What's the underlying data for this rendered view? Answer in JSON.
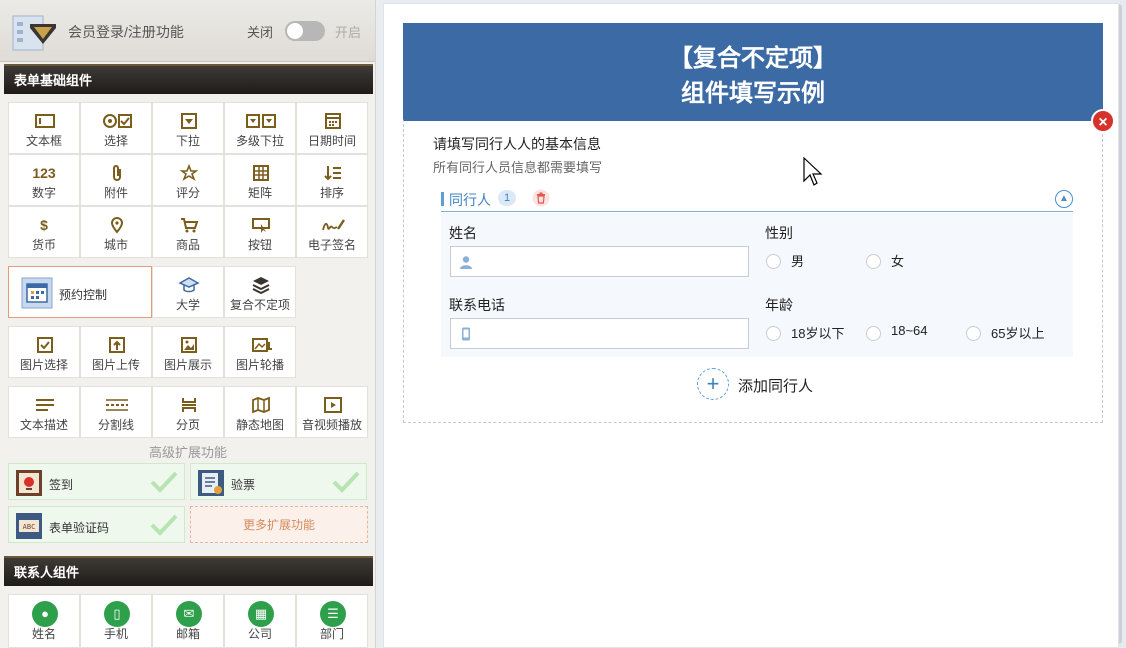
{
  "member": {
    "title": "会员登录/注册功能",
    "toggle_off": "关闭",
    "toggle_on": "开启"
  },
  "basic": {
    "title": "表单基础组件",
    "row1": [
      {
        "label": "文本框",
        "icon": "textbox-icon"
      },
      {
        "label": "选择",
        "icon": "select-icon"
      },
      {
        "label": "下拉",
        "icon": "dropdown-icon"
      },
      {
        "label": "多级下拉",
        "icon": "multi-dropdown-icon"
      },
      {
        "label": "日期时间",
        "icon": "calendar-icon"
      }
    ],
    "row2": [
      {
        "label": "数字",
        "icon": "number-icon",
        "glyph": "123"
      },
      {
        "label": "附件",
        "icon": "attachment-icon"
      },
      {
        "label": "评分",
        "icon": "star-icon"
      },
      {
        "label": "矩阵",
        "icon": "matrix-icon"
      },
      {
        "label": "排序",
        "icon": "sort-icon"
      }
    ],
    "row3": [
      {
        "label": "货币",
        "icon": "currency-icon",
        "glyph": "$"
      },
      {
        "label": "城市",
        "icon": "location-icon"
      },
      {
        "label": "商品",
        "icon": "cart-icon"
      },
      {
        "label": "按钮",
        "icon": "button-icon"
      },
      {
        "label": "电子签名",
        "icon": "signature-icon"
      }
    ],
    "appointment": "预约控制",
    "row4": [
      {
        "label": "大学",
        "icon": "university-icon"
      },
      {
        "label": "复合不定项",
        "icon": "layers-icon"
      }
    ],
    "row5": [
      {
        "label": "图片选择",
        "icon": "image-select-icon"
      },
      {
        "label": "图片上传",
        "icon": "image-upload-icon"
      },
      {
        "label": "图片展示",
        "icon": "image-display-icon"
      },
      {
        "label": "图片轮播",
        "icon": "image-carousel-icon"
      }
    ],
    "row6": [
      {
        "label": "文本描述",
        "icon": "text-desc-icon"
      },
      {
        "label": "分割线",
        "icon": "divider-icon"
      },
      {
        "label": "分页",
        "icon": "pagination-icon"
      },
      {
        "label": "静态地图",
        "icon": "map-icon"
      },
      {
        "label": "音视频播放",
        "icon": "media-play-icon"
      }
    ]
  },
  "advanced": {
    "title": "高级扩展功能",
    "items": [
      {
        "label": "签到",
        "icon": "checkin-icon"
      },
      {
        "label": "验票",
        "icon": "ticket-check-icon"
      },
      {
        "label": "表单验证码",
        "icon": "captcha-icon"
      }
    ],
    "more": "更多扩展功能"
  },
  "contact": {
    "title": "联系人组件",
    "items": [
      {
        "label": "姓名",
        "icon": "person-icon"
      },
      {
        "label": "手机",
        "icon": "phone-icon"
      },
      {
        "label": "邮箱",
        "icon": "mail-icon"
      },
      {
        "label": "公司",
        "icon": "company-icon"
      },
      {
        "label": "部门",
        "icon": "department-icon"
      }
    ]
  },
  "form": {
    "banner_line1": "【复合不定项】",
    "banner_line2": "组件填写示例",
    "component_title": "请填写同行人人的基本信息",
    "component_desc": "所有同行人员信息都需要填写",
    "group_name": "同行人",
    "group_count": "1",
    "fields": {
      "name_label": "姓名",
      "gender_label": "性别",
      "gender_options": [
        "男",
        "女"
      ],
      "phone_label": "联系电话",
      "age_label": "年龄",
      "age_options": [
        "18岁以下",
        "18~64",
        "65岁以上"
      ]
    },
    "add_label": "添加同行人"
  },
  "colors": {
    "banner": "#3c6aa4",
    "accent": "#3d83c2",
    "delete": "#d6312b",
    "icon_gold": "#7b5d1c",
    "contact_green": "#2e9f4a"
  }
}
